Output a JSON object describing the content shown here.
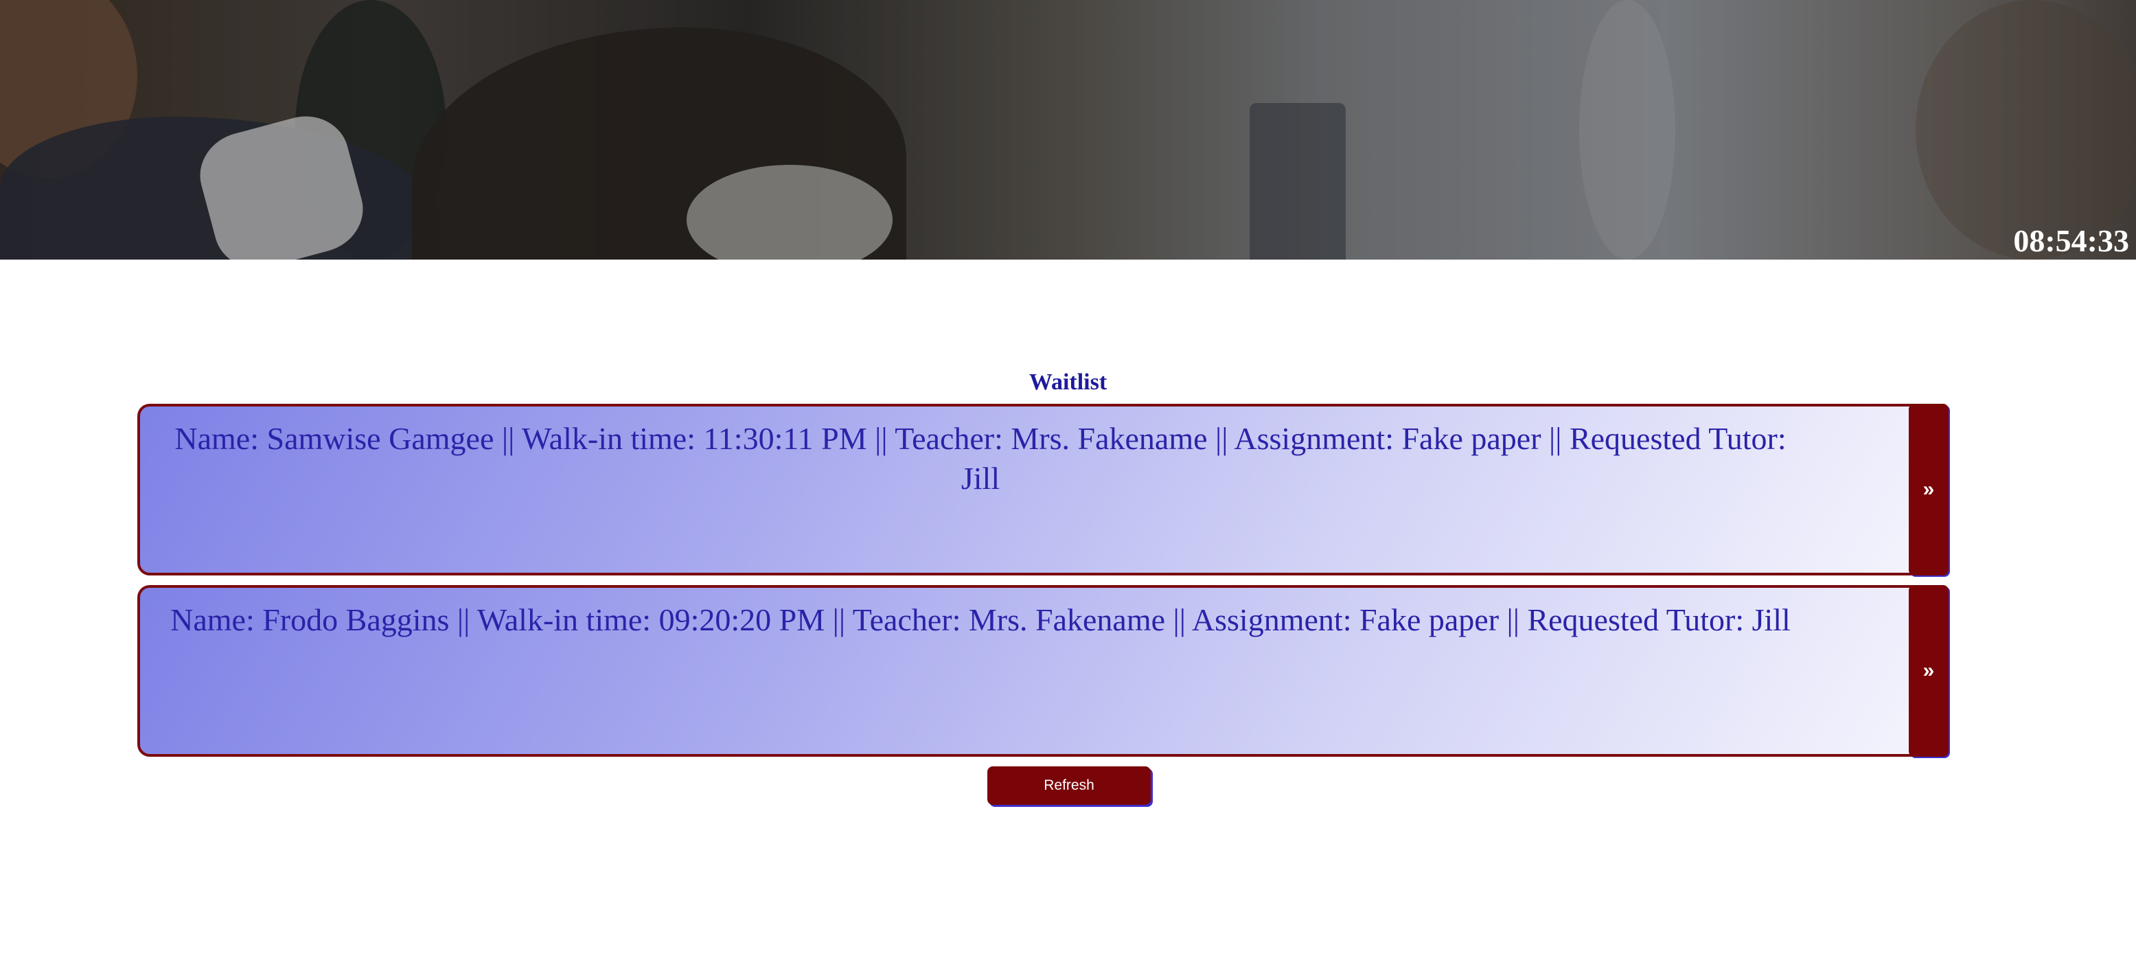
{
  "header": {
    "clock": "08:54:33"
  },
  "waitlist": {
    "title": "Waitlist",
    "entries": [
      {
        "text": "Name: Samwise Gamgee || Walk-in time: 11:30:11 PM || Teacher: Mrs. Fakename || Assignment: Fake paper || Requested Tutor: Jill",
        "action_label": "»"
      },
      {
        "text": "Name: Frodo Baggins || Walk-in time: 09:20:20 PM || Teacher: Mrs. Fakename || Assignment: Fake paper || Requested Tutor: Jill",
        "action_label": "»"
      }
    ],
    "refresh_label": "Refresh"
  },
  "colors": {
    "accent": "#7a0508",
    "text": "#2a23a8",
    "title": "#1f1b9c"
  }
}
